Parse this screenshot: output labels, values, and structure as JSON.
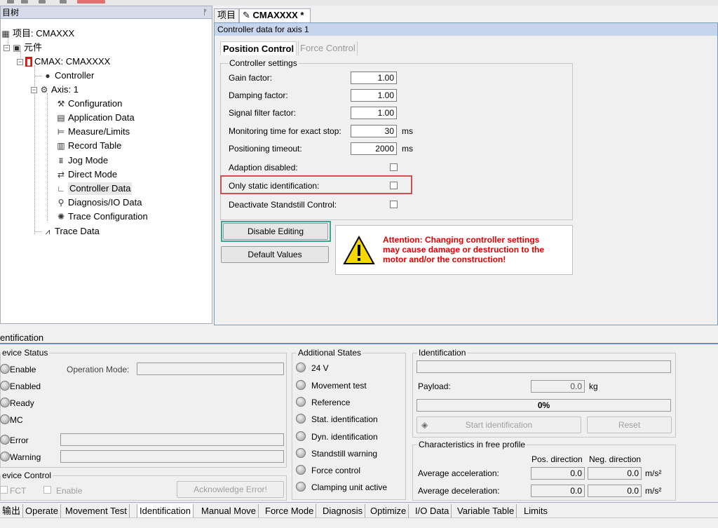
{
  "tree_panel": {
    "title": "目树",
    "pin": "ᚠ",
    "items": [
      {
        "label": "项目: CMAXXX",
        "icon": "project-icon"
      },
      {
        "label": "元件",
        "icon": "components-icon"
      },
      {
        "label": "CMAX: CMAXXXX",
        "icon": "device-icon"
      },
      {
        "label": "Controller",
        "icon": "controller-icon"
      },
      {
        "label": "Axis: 1",
        "icon": "axis-icon"
      },
      {
        "label": "Configuration",
        "icon": "configuration-icon"
      },
      {
        "label": "Application Data",
        "icon": "application-data-icon"
      },
      {
        "label": "Measure/Limits",
        "icon": "measure-icon"
      },
      {
        "label": "Record Table",
        "icon": "record-table-icon"
      },
      {
        "label": "Jog Mode",
        "icon": "jog-icon"
      },
      {
        "label": "Direct Mode",
        "icon": "direct-mode-icon"
      },
      {
        "label": "Controller Data",
        "icon": "controller-data-icon"
      },
      {
        "label": "Diagnosis/IO Data",
        "icon": "magnifier-icon"
      },
      {
        "label": "Trace Configuration",
        "icon": "trace-config-icon"
      },
      {
        "label": "Trace Data",
        "icon": "trace-data-icon"
      }
    ]
  },
  "doc_tabs": {
    "project_tab": "项目",
    "active_tab": "CMAXXXX *"
  },
  "controller_panel": {
    "title": "Controller data for axis 1",
    "subtabs": {
      "position": "Position Control",
      "force": "Force Control"
    },
    "settings_legend": "Controller settings",
    "fields": [
      {
        "label": "Gain factor:",
        "value": "1.00",
        "unit": ""
      },
      {
        "label": "Damping factor:",
        "value": "1.00",
        "unit": ""
      },
      {
        "label": "Signal filter factor:",
        "value": "1.00",
        "unit": ""
      },
      {
        "label": "Monitoring time for exact stop:",
        "value": "30",
        "unit": "ms"
      },
      {
        "label": "Positioning timeout:",
        "value": "2000",
        "unit": "ms"
      }
    ],
    "checkboxes": [
      {
        "label": "Adaption disabled:"
      },
      {
        "label": "Only static identification:"
      },
      {
        "label": "Deactivate Standstill Control:"
      }
    ],
    "disable_editing": "Disable Editing",
    "default_values": "Default Values",
    "attention_line1": "Attention: Changing controller settings",
    "attention_line2": "may cause damage or destruction to the",
    "attention_line3": "motor and/or the construction!"
  },
  "identification_panel": {
    "title": "entification",
    "device_status": {
      "legend": "evice Status",
      "operation_mode_label": "Operation Mode:",
      "leds": [
        "Enable",
        "Enabled",
        "Ready",
        "MC",
        "Error",
        "Warning"
      ]
    },
    "device_control": {
      "legend": "evice Control",
      "fct": "FCT",
      "enable": "Enable",
      "ack": "Acknowledge Error!"
    },
    "additional_states": {
      "legend": "Additional States",
      "items": [
        "24 V",
        "Movement test",
        "Reference",
        "Stat. identification",
        "Dyn. identification",
        "Standstill warning",
        "Force control",
        "Clamping unit active"
      ]
    },
    "identification": {
      "legend": "Identification",
      "payload_label": "Payload:",
      "payload_value": "0.0",
      "payload_unit": "kg",
      "progress": "0%",
      "progress_value": 0,
      "start": "Start identification",
      "reset": "Reset"
    },
    "characteristics": {
      "legend": "Characteristics in free profile",
      "pos_header": "Pos. direction",
      "neg_header": "Neg. direction",
      "rows": [
        {
          "label": "Average acceleration:",
          "pos": "0.0",
          "neg": "0.0",
          "unit": "m/s²"
        },
        {
          "label": "Average deceleration:",
          "pos": "0.0",
          "neg": "0.0",
          "unit": "m/s²"
        }
      ]
    }
  },
  "bottom_tabs": [
    "输出",
    "Operate",
    "Movement Test",
    "Identification",
    "Manual Move",
    "Force Mode",
    "Diagnosis",
    "Optimize",
    "I/O Data",
    "Variable Table",
    "Limits"
  ],
  "colors": {
    "attention": "#e00000",
    "highlight_red": "#d05050",
    "highlight_green": "#3aa890",
    "panel_title": "#c6d4ec"
  }
}
